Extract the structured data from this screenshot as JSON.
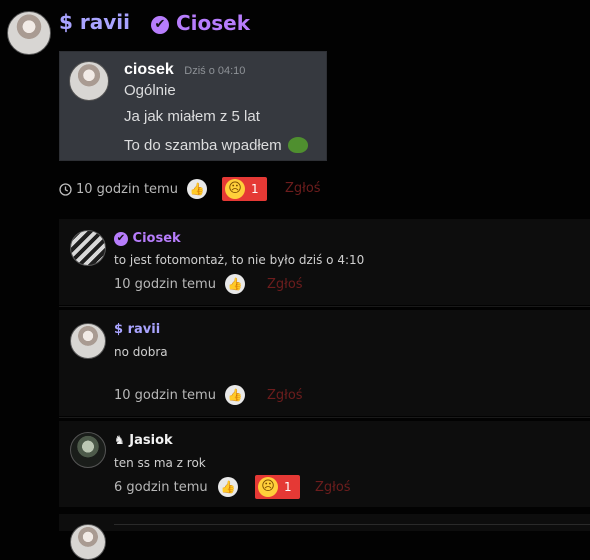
{
  "post": {
    "author_prefix": "$",
    "author": "ravii",
    "target_badge": "✔",
    "target": "Ciosek",
    "embed": {
      "author": "ciosek",
      "time": "Dziś o 04:10",
      "lines": [
        "Ogólnie",
        "Ja jak miałem z 5 lat",
        "To do szamba wpadłem"
      ]
    },
    "time_ago": "10 godzin temu",
    "reaction_count": "1",
    "report": "Zgłoś"
  },
  "comments": [
    {
      "prefix": "✔",
      "author": "Ciosek",
      "text": "to jest fotomontaż, to nie było dziś o 4:10",
      "time_ago": "10 godzin temu",
      "report": "Zgłoś"
    },
    {
      "prefix": "$",
      "author": "ravii",
      "text": "no dobra",
      "time_ago": "10 godzin temu",
      "report": "Zgłoś"
    },
    {
      "prefix": "♞",
      "author": "Jasiok",
      "text": "ten ss ma z rok",
      "time_ago": "6 godzin temu",
      "reaction_count": "1",
      "report": "Zgłoś"
    }
  ],
  "icons": {
    "clock": "clock-icon",
    "thumb": "thumbs-up-icon",
    "reaction": "confused-face-icon",
    "pepe": "frog-emoji-icon"
  },
  "colors": {
    "background": "#020202",
    "purple": "#b77dfc",
    "username": "#a9a4ff",
    "reaction": "#e53935",
    "report": "#6d1d1d"
  }
}
